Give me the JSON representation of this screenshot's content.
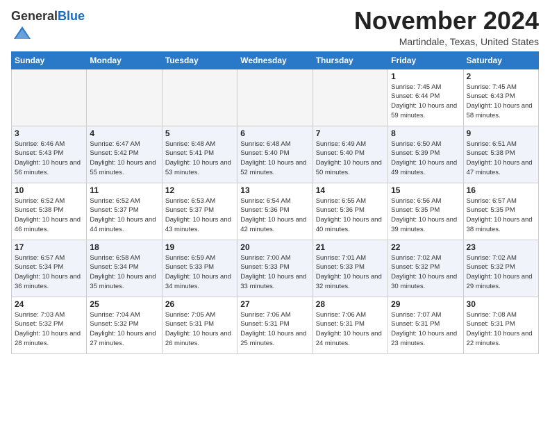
{
  "header": {
    "logo_general": "General",
    "logo_blue": "Blue",
    "month": "November 2024",
    "location": "Martindale, Texas, United States"
  },
  "days_of_week": [
    "Sunday",
    "Monday",
    "Tuesday",
    "Wednesday",
    "Thursday",
    "Friday",
    "Saturday"
  ],
  "weeks": [
    [
      {
        "day": "",
        "info": ""
      },
      {
        "day": "",
        "info": ""
      },
      {
        "day": "",
        "info": ""
      },
      {
        "day": "",
        "info": ""
      },
      {
        "day": "",
        "info": ""
      },
      {
        "day": "1",
        "info": "Sunrise: 7:45 AM\nSunset: 6:44 PM\nDaylight: 10 hours and 59 minutes."
      },
      {
        "day": "2",
        "info": "Sunrise: 7:45 AM\nSunset: 6:43 PM\nDaylight: 10 hours and 58 minutes."
      }
    ],
    [
      {
        "day": "3",
        "info": "Sunrise: 6:46 AM\nSunset: 5:43 PM\nDaylight: 10 hours and 56 minutes."
      },
      {
        "day": "4",
        "info": "Sunrise: 6:47 AM\nSunset: 5:42 PM\nDaylight: 10 hours and 55 minutes."
      },
      {
        "day": "5",
        "info": "Sunrise: 6:48 AM\nSunset: 5:41 PM\nDaylight: 10 hours and 53 minutes."
      },
      {
        "day": "6",
        "info": "Sunrise: 6:48 AM\nSunset: 5:40 PM\nDaylight: 10 hours and 52 minutes."
      },
      {
        "day": "7",
        "info": "Sunrise: 6:49 AM\nSunset: 5:40 PM\nDaylight: 10 hours and 50 minutes."
      },
      {
        "day": "8",
        "info": "Sunrise: 6:50 AM\nSunset: 5:39 PM\nDaylight: 10 hours and 49 minutes."
      },
      {
        "day": "9",
        "info": "Sunrise: 6:51 AM\nSunset: 5:38 PM\nDaylight: 10 hours and 47 minutes."
      }
    ],
    [
      {
        "day": "10",
        "info": "Sunrise: 6:52 AM\nSunset: 5:38 PM\nDaylight: 10 hours and 46 minutes."
      },
      {
        "day": "11",
        "info": "Sunrise: 6:52 AM\nSunset: 5:37 PM\nDaylight: 10 hours and 44 minutes."
      },
      {
        "day": "12",
        "info": "Sunrise: 6:53 AM\nSunset: 5:37 PM\nDaylight: 10 hours and 43 minutes."
      },
      {
        "day": "13",
        "info": "Sunrise: 6:54 AM\nSunset: 5:36 PM\nDaylight: 10 hours and 42 minutes."
      },
      {
        "day": "14",
        "info": "Sunrise: 6:55 AM\nSunset: 5:36 PM\nDaylight: 10 hours and 40 minutes."
      },
      {
        "day": "15",
        "info": "Sunrise: 6:56 AM\nSunset: 5:35 PM\nDaylight: 10 hours and 39 minutes."
      },
      {
        "day": "16",
        "info": "Sunrise: 6:57 AM\nSunset: 5:35 PM\nDaylight: 10 hours and 38 minutes."
      }
    ],
    [
      {
        "day": "17",
        "info": "Sunrise: 6:57 AM\nSunset: 5:34 PM\nDaylight: 10 hours and 36 minutes."
      },
      {
        "day": "18",
        "info": "Sunrise: 6:58 AM\nSunset: 5:34 PM\nDaylight: 10 hours and 35 minutes."
      },
      {
        "day": "19",
        "info": "Sunrise: 6:59 AM\nSunset: 5:33 PM\nDaylight: 10 hours and 34 minutes."
      },
      {
        "day": "20",
        "info": "Sunrise: 7:00 AM\nSunset: 5:33 PM\nDaylight: 10 hours and 33 minutes."
      },
      {
        "day": "21",
        "info": "Sunrise: 7:01 AM\nSunset: 5:33 PM\nDaylight: 10 hours and 32 minutes."
      },
      {
        "day": "22",
        "info": "Sunrise: 7:02 AM\nSunset: 5:32 PM\nDaylight: 10 hours and 30 minutes."
      },
      {
        "day": "23",
        "info": "Sunrise: 7:02 AM\nSunset: 5:32 PM\nDaylight: 10 hours and 29 minutes."
      }
    ],
    [
      {
        "day": "24",
        "info": "Sunrise: 7:03 AM\nSunset: 5:32 PM\nDaylight: 10 hours and 28 minutes."
      },
      {
        "day": "25",
        "info": "Sunrise: 7:04 AM\nSunset: 5:32 PM\nDaylight: 10 hours and 27 minutes."
      },
      {
        "day": "26",
        "info": "Sunrise: 7:05 AM\nSunset: 5:31 PM\nDaylight: 10 hours and 26 minutes."
      },
      {
        "day": "27",
        "info": "Sunrise: 7:06 AM\nSunset: 5:31 PM\nDaylight: 10 hours and 25 minutes."
      },
      {
        "day": "28",
        "info": "Sunrise: 7:06 AM\nSunset: 5:31 PM\nDaylight: 10 hours and 24 minutes."
      },
      {
        "day": "29",
        "info": "Sunrise: 7:07 AM\nSunset: 5:31 PM\nDaylight: 10 hours and 23 minutes."
      },
      {
        "day": "30",
        "info": "Sunrise: 7:08 AM\nSunset: 5:31 PM\nDaylight: 10 hours and 22 minutes."
      }
    ]
  ]
}
